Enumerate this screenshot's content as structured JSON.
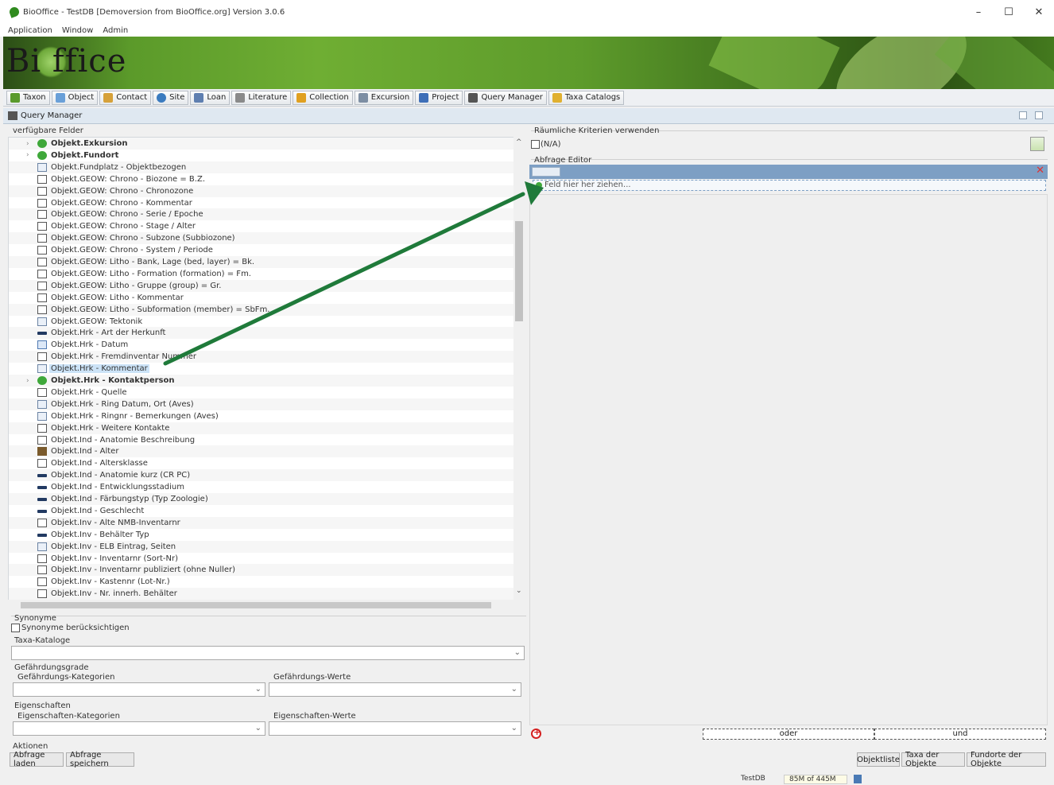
{
  "window": {
    "title": "BioOffice - TestDB [Demoversion from BioOffice.org] Version 3.0.6",
    "controls": {
      "minimize": "–",
      "maximize": "☐",
      "close": "✕"
    }
  },
  "menu": [
    "Application",
    "Window",
    "Admin"
  ],
  "banner": {
    "logo_text": "Bi   ffice"
  },
  "toolbar": [
    {
      "label": "Taxon",
      "icon": "leaf-icon",
      "color": "#5a9a2c"
    },
    {
      "label": "Object",
      "icon": "object-icon",
      "color": "#6aa0d8"
    },
    {
      "label": "Contact",
      "icon": "person-icon",
      "color": "#d6a13a"
    },
    {
      "label": "Site",
      "icon": "globe-icon",
      "color": "#3b7bbf"
    },
    {
      "label": "Loan",
      "icon": "loan-icon",
      "color": "#5f7fb0"
    },
    {
      "label": "Literature",
      "icon": "book-icon",
      "color": "#8a8a8a"
    },
    {
      "label": "Collection",
      "icon": "collection-icon",
      "color": "#e0a020"
    },
    {
      "label": "Excursion",
      "icon": "excursion-icon",
      "color": "#7d8ea3"
    },
    {
      "label": "Project",
      "icon": "flag-icon",
      "color": "#3f6fb8"
    },
    {
      "label": "Query Manager",
      "icon": "binoculars-icon",
      "color": "#555555"
    },
    {
      "label": "Taxa Catalogs",
      "icon": "catalog-icon",
      "color": "#e0b030"
    }
  ],
  "tab": {
    "label": "Query Manager"
  },
  "left": {
    "fields_label": "verfügbare Felder",
    "tree": [
      {
        "text": "Objekt.Exkursion",
        "type": "group"
      },
      {
        "text": "Objekt.Fundort",
        "type": "group"
      },
      {
        "text": "Objekt.Fundplatz - Objektbezogen",
        "type": "note"
      },
      {
        "text": "Objekt.GEOW: Chrono - Biozone = B.Z.",
        "type": "table"
      },
      {
        "text": "Objekt.GEOW: Chrono - Chronozone",
        "type": "table"
      },
      {
        "text": "Objekt.GEOW: Chrono - Kommentar",
        "type": "table"
      },
      {
        "text": "Objekt.GEOW: Chrono - Serie / Epoche",
        "type": "table"
      },
      {
        "text": "Objekt.GEOW: Chrono - Stage / Alter",
        "type": "table"
      },
      {
        "text": "Objekt.GEOW: Chrono - Subzone (Subbiozone)",
        "type": "table"
      },
      {
        "text": "Objekt.GEOW: Chrono - System / Periode",
        "type": "table"
      },
      {
        "text": "Objekt.GEOW: Litho - Bank, Lage (bed, layer) = Bk.",
        "type": "table"
      },
      {
        "text": "Objekt.GEOW: Litho - Formation (formation) = Fm.",
        "type": "table"
      },
      {
        "text": "Objekt.GEOW: Litho - Gruppe (group) = Gr.",
        "type": "table"
      },
      {
        "text": "Objekt.GEOW: Litho - Kommentar",
        "type": "table"
      },
      {
        "text": "Objekt.GEOW: Litho - Subformation (member) = SbFm.",
        "type": "table"
      },
      {
        "text": "Objekt.GEOW: Tektonik",
        "type": "note"
      },
      {
        "text": "Objekt.Hrk - Art der Herkunft",
        "type": "bar"
      },
      {
        "text": "Objekt.Hrk - Datum",
        "type": "cal"
      },
      {
        "text": "Objekt.Hrk - Fremdinventar Nummer",
        "type": "table"
      },
      {
        "text": "Objekt.Hrk - Kommentar",
        "type": "note",
        "selected": true
      },
      {
        "text": "Objekt.Hrk - Kontaktperson",
        "type": "group"
      },
      {
        "text": "Objekt.Hrk - Quelle",
        "type": "table"
      },
      {
        "text": "Objekt.Hrk - Ring Datum, Ort (Aves)",
        "type": "note"
      },
      {
        "text": "Objekt.Hrk - Ringnr - Bemerkungen (Aves)",
        "type": "note"
      },
      {
        "text": "Objekt.Hrk - Weitere Kontakte",
        "type": "table"
      },
      {
        "text": "Objekt.Ind -  Anatomie Beschreibung",
        "type": "table"
      },
      {
        "text": "Objekt.Ind - Alter",
        "type": "num"
      },
      {
        "text": "Objekt.Ind - Altersklasse",
        "type": "table"
      },
      {
        "text": "Objekt.Ind - Anatomie kurz (CR PC)",
        "type": "bar"
      },
      {
        "text": "Objekt.Ind - Entwicklungsstadium",
        "type": "bar"
      },
      {
        "text": "Objekt.Ind - Färbungstyp (Typ Zoologie)",
        "type": "bar"
      },
      {
        "text": "Objekt.Ind - Geschlecht",
        "type": "bar"
      },
      {
        "text": "Objekt.Inv - Alte NMB-Inventarnr",
        "type": "table"
      },
      {
        "text": "Objekt.Inv - Behälter Typ",
        "type": "bar"
      },
      {
        "text": "Objekt.Inv - ELB Eintrag, Seiten",
        "type": "note"
      },
      {
        "text": "Objekt.Inv - Inventarnr (Sort-Nr)",
        "type": "table"
      },
      {
        "text": "Objekt.Inv - Inventarnr publiziert (ohne Nuller)",
        "type": "table"
      },
      {
        "text": "Objekt.Inv - Kastennr (Lot-Nr.)",
        "type": "table"
      },
      {
        "text": "Objekt.Inv - Nr. innerh. Behälter",
        "type": "table"
      }
    ],
    "synonyme": {
      "group": "Synonyme",
      "checkbox": "Synonyme berücksichtigen"
    },
    "taxa": {
      "label": "Taxa-Kataloge"
    },
    "gefahr": {
      "group": "Gefährdungsgrade",
      "kategorien": "Gefährdungs-Kategorien",
      "werte": "Gefährdungs-Werte"
    },
    "eigen": {
      "group": "Eigenschaften",
      "kategorien": "Eigenschaften-Kategorien",
      "werte": "Eigenschaften-Werte"
    },
    "aktionen": {
      "group": "Aktionen",
      "load": "Abfrage laden",
      "save": "Abfrage speichern"
    }
  },
  "right": {
    "spatial_label": "Räumliche Kriterien verwenden",
    "spatial_checkbox": "(N/A)",
    "editor_label": "Abfrage Editor",
    "dropzone": "Feld hier her ziehen...",
    "oder": "oder",
    "und": "und",
    "buttons": [
      "Objektliste",
      "Taxa der Objekte",
      "Fundorte der Objekte"
    ]
  },
  "status": {
    "db": "TestDB",
    "memory": "85M of 445M"
  },
  "colors": {
    "arrow": "#1f7a3a",
    "editor_bar": "#7d9fc4"
  }
}
